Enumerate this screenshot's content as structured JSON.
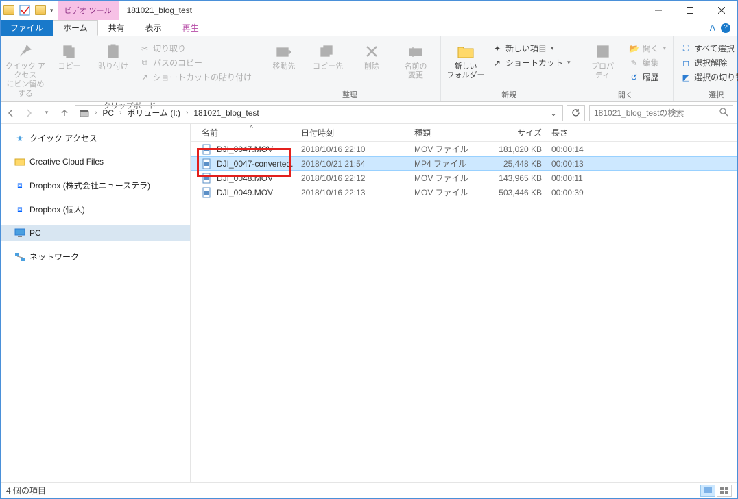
{
  "window": {
    "title": "181021_blog_test",
    "contextual_tab": "ビデオ ツール"
  },
  "tabs": {
    "file": "ファイル",
    "home": "ホーム",
    "share": "共有",
    "view": "表示",
    "play": "再生"
  },
  "ribbon": {
    "pin": {
      "label": "クイック アクセス\nにピン留めする"
    },
    "copy": {
      "label": "コピー"
    },
    "paste": {
      "label": "貼り付け"
    },
    "cut": "切り取り",
    "copy_path": "パスのコピー",
    "paste_shortcut": "ショートカットの貼り付け",
    "group_clipboard": "クリップボード",
    "move_to": "移動先",
    "copy_to": "コピー先",
    "delete": "削除",
    "rename": "名前の\n変更",
    "group_organize": "整理",
    "new_folder": "新しい\nフォルダー",
    "new_item": "新しい項目",
    "shortcut": "ショートカット",
    "group_new": "新規",
    "properties": "プロパ\nティ",
    "open": "開く",
    "edit": "編集",
    "history": "履歴",
    "group_open": "開く",
    "select_all": "すべて選択",
    "select_none": "選択解除",
    "invert_selection": "選択の切り替え",
    "group_select": "選択"
  },
  "breadcrumb": {
    "pc": "PC",
    "volume": "ボリューム (I:)",
    "folder": "181021_blog_test"
  },
  "search": {
    "placeholder": "181021_blog_testの検索"
  },
  "navpane": {
    "quick_access": "クイック アクセス",
    "creative_cloud": "Creative Cloud Files",
    "dropbox1": "Dropbox (株式会社ニューステラ)",
    "dropbox2": "Dropbox (個人)",
    "pc": "PC",
    "network": "ネットワーク"
  },
  "columns": {
    "name": "名前",
    "date": "日付時刻",
    "type": "種類",
    "size": "サイズ",
    "length": "長さ"
  },
  "files": [
    {
      "name": "DJI_0047.MOV",
      "date": "2018/10/16 22:10",
      "type": "MOV ファイル",
      "size": "181,020 KB",
      "length": "00:00:14"
    },
    {
      "name": "DJI_0047-converted.",
      "date": "2018/10/21 21:54",
      "type": "MP4 ファイル",
      "size": "25,448 KB",
      "length": "00:00:13"
    },
    {
      "name": "DJI_0048.MOV",
      "date": "2018/10/16 22:12",
      "type": "MOV ファイル",
      "size": "143,965 KB",
      "length": "00:00:11"
    },
    {
      "name": "DJI_0049.MOV",
      "date": "2018/10/16 22:13",
      "type": "MOV ファイル",
      "size": "503,446 KB",
      "length": "00:00:39"
    }
  ],
  "status": {
    "count": "4 個の項目"
  }
}
